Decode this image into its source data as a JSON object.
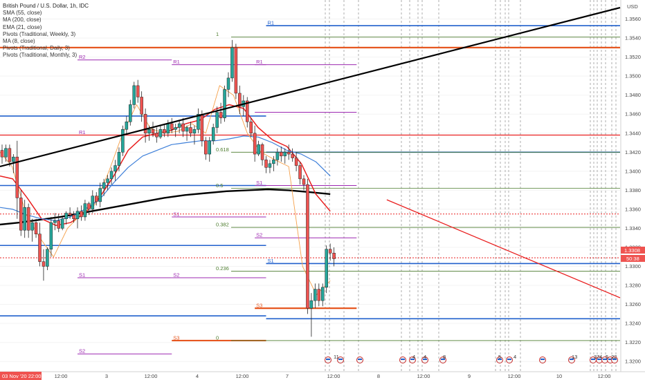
{
  "header": {
    "title": "British Pound / U.S. Dollar, 1h, IDC",
    "indicators": [
      "SMA (55, close)",
      "MA (200, close)",
      "EMA (21, close)",
      "Pivots (Traditional, Weekly, 3)",
      "MA (8, close)",
      "Pivots (Traditional, Daily, 3)",
      "Pivots (Traditional, Monthly, 3)"
    ]
  },
  "price_axis": {
    "currency": "USD",
    "current_price": "1.3308",
    "countdown": "50:38",
    "ticks": [
      "1.3560",
      "1.3540",
      "1.3520",
      "1.3500",
      "1.3480",
      "1.3460",
      "1.3440",
      "1.3420",
      "1.3400",
      "1.3380",
      "1.3360",
      "1.3340",
      "1.3320",
      "1.3300",
      "1.3280",
      "1.3260",
      "1.3240",
      "1.3220",
      "1.3200"
    ]
  },
  "time_axis": {
    "start_badge": "03 Nov '20  22:00",
    "ticks": [
      "12:00",
      "3",
      "12:00",
      "4",
      "12:00",
      "7",
      "12:00",
      "8",
      "12:00",
      "9",
      "12:00",
      "10",
      "12:00"
    ]
  },
  "colors": {
    "bull": "#26a69a",
    "bear": "#ef5350",
    "ma200": "#000000",
    "ema21": "#e91e1e",
    "sma55": "#3d7fd9",
    "ma8": "#f5a04a",
    "weekly_pivot": "#1f5fcc",
    "daily_pivot": "#9c27b0",
    "monthly_pivot": "#e6561f",
    "fib": "#4a7a2b",
    "trendline": "#e91e1e",
    "price_badge": "#ef5350"
  },
  "chart_data": {
    "type": "candlestick",
    "symbol": "GBPUSD",
    "interval": "1h",
    "y_range": [
      1.319,
      1.358
    ],
    "candles": [
      [
        1.3422,
        1.3428,
        1.3408,
        1.3415
      ],
      [
        1.3415,
        1.3428,
        1.341,
        1.3424
      ],
      [
        1.3424,
        1.3428,
        1.3405,
        1.341
      ],
      [
        1.341,
        1.3418,
        1.3398,
        1.3415
      ],
      [
        1.3415,
        1.3432,
        1.335,
        1.3372
      ],
      [
        1.3372,
        1.338,
        1.3332,
        1.3338
      ],
      [
        1.3338,
        1.337,
        1.333,
        1.3362
      ],
      [
        1.3362,
        1.3366,
        1.333,
        1.3338
      ],
      [
        1.3338,
        1.335,
        1.3326,
        1.3346
      ],
      [
        1.3346,
        1.335,
        1.333,
        1.3334
      ],
      [
        1.3334,
        1.3346,
        1.33,
        1.3305
      ],
      [
        1.3305,
        1.3318,
        1.3285,
        1.33
      ],
      [
        1.33,
        1.332,
        1.3296,
        1.3318
      ],
      [
        1.3318,
        1.3352,
        1.331,
        1.3346
      ],
      [
        1.3346,
        1.3356,
        1.3338,
        1.3348
      ],
      [
        1.3348,
        1.3355,
        1.3336,
        1.334
      ],
      [
        1.334,
        1.3352,
        1.3338,
        1.335
      ],
      [
        1.335,
        1.3358,
        1.3344,
        1.3356
      ],
      [
        1.3356,
        1.3362,
        1.335,
        1.3354
      ],
      [
        1.3354,
        1.3358,
        1.3346,
        1.335
      ],
      [
        1.335,
        1.3362,
        1.334,
        1.3358
      ],
      [
        1.3358,
        1.3364,
        1.3348,
        1.3352
      ],
      [
        1.3352,
        1.337,
        1.3348,
        1.3366
      ],
      [
        1.3366,
        1.3368,
        1.3354,
        1.336
      ],
      [
        1.336,
        1.338,
        1.3356,
        1.3374
      ],
      [
        1.3374,
        1.3378,
        1.3364,
        1.3368
      ],
      [
        1.3368,
        1.3388,
        1.3362,
        1.3382
      ],
      [
        1.3382,
        1.3392,
        1.3374,
        1.3388
      ],
      [
        1.3388,
        1.3396,
        1.338,
        1.3392
      ],
      [
        1.3392,
        1.3404,
        1.3386,
        1.34
      ],
      [
        1.34,
        1.3412,
        1.339,
        1.3406
      ],
      [
        1.3406,
        1.3425,
        1.34,
        1.342
      ],
      [
        1.342,
        1.3448,
        1.3416,
        1.3444
      ],
      [
        1.3444,
        1.3458,
        1.3438,
        1.3452
      ],
      [
        1.3452,
        1.3475,
        1.3448,
        1.347
      ],
      [
        1.347,
        1.3494,
        1.3466,
        1.349
      ],
      [
        1.349,
        1.3496,
        1.3472,
        1.3478
      ],
      [
        1.3478,
        1.3484,
        1.3452,
        1.346
      ],
      [
        1.346,
        1.3466,
        1.343,
        1.344
      ],
      [
        1.344,
        1.3448,
        1.3432,
        1.3444
      ],
      [
        1.3444,
        1.3452,
        1.3436,
        1.344
      ],
      [
        1.344,
        1.3446,
        1.343,
        1.3436
      ],
      [
        1.3436,
        1.3448,
        1.3434,
        1.3444
      ],
      [
        1.3444,
        1.345,
        1.3436,
        1.344
      ],
      [
        1.344,
        1.3454,
        1.3436,
        1.345
      ],
      [
        1.345,
        1.3456,
        1.344,
        1.3444
      ],
      [
        1.3444,
        1.345,
        1.3436,
        1.3446
      ],
      [
        1.3446,
        1.3454,
        1.344,
        1.345
      ],
      [
        1.345,
        1.3456,
        1.3436,
        1.3442
      ],
      [
        1.3442,
        1.3448,
        1.3432,
        1.3446
      ],
      [
        1.3446,
        1.3452,
        1.3436,
        1.344
      ],
      [
        1.344,
        1.3448,
        1.3428,
        1.3444
      ],
      [
        1.3444,
        1.3466,
        1.344,
        1.346
      ],
      [
        1.346,
        1.3464,
        1.3426,
        1.3432
      ],
      [
        1.3432,
        1.3436,
        1.3412,
        1.3418
      ],
      [
        1.3418,
        1.3436,
        1.341,
        1.3432
      ],
      [
        1.3432,
        1.345,
        1.3428,
        1.3446
      ],
      [
        1.3446,
        1.3468,
        1.344,
        1.3462
      ],
      [
        1.3462,
        1.3472,
        1.345,
        1.3456
      ],
      [
        1.3456,
        1.349,
        1.3452,
        1.3486
      ],
      [
        1.3486,
        1.3504,
        1.3478,
        1.3498
      ],
      [
        1.3498,
        1.3538,
        1.3494,
        1.353
      ],
      [
        1.353,
        1.3534,
        1.3476,
        1.3482
      ],
      [
        1.3482,
        1.349,
        1.346,
        1.3468
      ],
      [
        1.3468,
        1.348,
        1.3458,
        1.3474
      ],
      [
        1.3474,
        1.3478,
        1.3446,
        1.3452
      ],
      [
        1.3452,
        1.3456,
        1.3436,
        1.344
      ],
      [
        1.344,
        1.3448,
        1.341,
        1.3418
      ],
      [
        1.3418,
        1.3432,
        1.3416,
        1.3428
      ],
      [
        1.3428,
        1.343,
        1.3406,
        1.3412
      ],
      [
        1.3412,
        1.3416,
        1.3398,
        1.3404
      ],
      [
        1.3404,
        1.3412,
        1.3398,
        1.3408
      ],
      [
        1.3408,
        1.3416,
        1.34,
        1.3412
      ],
      [
        1.3412,
        1.3424,
        1.3406,
        1.342
      ],
      [
        1.342,
        1.3426,
        1.341,
        1.3416
      ],
      [
        1.3416,
        1.3424,
        1.3408,
        1.342
      ],
      [
        1.342,
        1.3428,
        1.3412,
        1.3418
      ],
      [
        1.3418,
        1.3424,
        1.341,
        1.3414
      ],
      [
        1.3414,
        1.342,
        1.34,
        1.3406
      ],
      [
        1.3406,
        1.341,
        1.3386,
        1.3392
      ],
      [
        1.3392,
        1.3396,
        1.338,
        1.3386
      ],
      [
        1.3386,
        1.3392,
        1.325,
        1.3256
      ],
      [
        1.3256,
        1.3272,
        1.3226,
        1.3264
      ],
      [
        1.3264,
        1.3282,
        1.3256,
        1.3276
      ],
      [
        1.3276,
        1.3282,
        1.3258,
        1.3264
      ],
      [
        1.3264,
        1.3282,
        1.3258,
        1.3278
      ],
      [
        1.3278,
        1.3322,
        1.3272,
        1.3318
      ],
      [
        1.3318,
        1.3324,
        1.3306,
        1.3314
      ],
      [
        1.3314,
        1.332,
        1.33,
        1.3308
      ]
    ],
    "moving_averages": [
      {
        "name": "MA (200, close)",
        "from_x": -1,
        "to_x": 87,
        "values": [
          1.3344,
          1.3346,
          1.3349,
          1.3352,
          1.3356,
          1.336,
          1.3364,
          1.3368,
          1.3372,
          1.3375,
          1.3377,
          1.3379,
          1.338,
          1.3381,
          1.338,
          1.3378,
          1.3376
        ]
      },
      {
        "name": "EMA (21, close)",
        "from_x": -1,
        "to_x": 87,
        "values": [
          1.3395,
          1.3392,
          1.3372,
          1.335,
          1.3343,
          1.3346,
          1.3356,
          1.3372,
          1.3395,
          1.3422,
          1.3436,
          1.344,
          1.3443,
          1.345,
          1.3454,
          1.3465,
          1.347,
          1.3466,
          1.3446,
          1.3433,
          1.3426,
          1.3408,
          1.3376,
          1.3358
        ]
      },
      {
        "name": "SMA (55, close)",
        "from_x": -1,
        "to_x": 87,
        "values": [
          1.3362,
          1.336,
          1.3354,
          1.335,
          1.3348,
          1.3352,
          1.336,
          1.337,
          1.3388,
          1.3404,
          1.3416,
          1.3422,
          1.3428,
          1.343,
          1.3432,
          1.3432,
          1.3434,
          1.3437,
          1.3436,
          1.343,
          1.3422,
          1.3418,
          1.341,
          1.3395
        ]
      },
      {
        "name": "MA (8, close)",
        "from_x": -1,
        "to_x": 87,
        "values": [
          1.342,
          1.3405,
          1.3355,
          1.333,
          1.331,
          1.334,
          1.3355,
          1.3365,
          1.34,
          1.344,
          1.347,
          1.3445,
          1.344,
          1.3442,
          1.345,
          1.344,
          1.349,
          1.348,
          1.344,
          1.342,
          1.3412,
          1.3405,
          1.33,
          1.327,
          1.3285
        ]
      }
    ],
    "pivot_levels": [
      {
        "group": "weekly",
        "label": "R1",
        "price": 1.3553,
        "from_x": 70,
        "to_x": 200
      },
      {
        "group": "weekly",
        "label": "",
        "price": 1.3458,
        "from_x": -1,
        "to_x": 70
      },
      {
        "group": "weekly",
        "label": "",
        "price": 1.342,
        "from_x": 70,
        "to_x": 200
      },
      {
        "group": "weekly",
        "label": "",
        "price": 1.3385,
        "from_x": -1,
        "to_x": 70
      },
      {
        "group": "weekly",
        "label": "",
        "price": 1.3322,
        "from_x": -1,
        "to_x": 70
      },
      {
        "group": "weekly",
        "label": "S1",
        "price": 1.3303,
        "from_x": 70,
        "to_x": 200
      },
      {
        "group": "weekly",
        "label": "",
        "price": 1.3248,
        "from_x": -1,
        "to_x": 70
      },
      {
        "group": "weekly",
        "label": "",
        "price": 1.3245,
        "from_x": 70,
        "to_x": 200
      },
      {
        "group": "daily",
        "label": "R1",
        "price": 1.3512,
        "from_x": 45,
        "to_x": 70
      },
      {
        "group": "daily",
        "label": "R1",
        "price": 1.3512,
        "from_x": 67,
        "to_x": 94
      },
      {
        "group": "daily",
        "label": "R2",
        "price": 1.3517,
        "from_x": 20,
        "to_x": 45
      },
      {
        "group": "daily",
        "label": "",
        "price": 1.3462,
        "from_x": 67,
        "to_x": 94
      },
      {
        "group": "daily",
        "label": "S1",
        "price": 1.3385,
        "from_x": 67,
        "to_x": 94
      },
      {
        "group": "daily",
        "label": "S1",
        "price": 1.3352,
        "from_x": 45,
        "to_x": 70
      },
      {
        "group": "daily",
        "label": "S2",
        "price": 1.333,
        "from_x": 67,
        "to_x": 94
      },
      {
        "group": "daily",
        "label": "S1",
        "price": 1.3288,
        "from_x": 20,
        "to_x": 45
      },
      {
        "group": "daily",
        "label": "S2",
        "price": 1.3288,
        "from_x": 45,
        "to_x": 70
      },
      {
        "group": "daily",
        "label": "S2",
        "price": 1.3208,
        "from_x": 20,
        "to_x": 45
      },
      {
        "group": "daily",
        "label": "R1",
        "price": 1.3438,
        "from_x": 20,
        "to_x": 45
      },
      {
        "group": "monthly",
        "label": "",
        "price": 1.353,
        "from_x": -1,
        "to_x": 200
      },
      {
        "group": "monthly",
        "label": "S3",
        "price": 1.3256,
        "from_x": 67,
        "to_x": 94
      },
      {
        "group": "monthly",
        "label": "S3",
        "price": 1.3222,
        "from_x": 45,
        "to_x": 70
      }
    ],
    "red_levels": [
      {
        "price": 1.3438,
        "style": "solid",
        "from_x": -1,
        "to_x": 200
      },
      {
        "price": 1.3355,
        "style": "dotted",
        "from_x": -1,
        "to_x": 200
      },
      {
        "price": 1.3309,
        "style": "dotted",
        "from_x": -1,
        "to_x": 200
      }
    ],
    "fib_levels": [
      {
        "label": "1",
        "price": 1.3541
      },
      {
        "label": "0.618",
        "price": 1.342
      },
      {
        "label": "0.5",
        "price": 1.3382
      },
      {
        "label": "0.382",
        "price": 1.3341
      },
      {
        "label": "0.236",
        "price": 1.3295
      },
      {
        "label": "0",
        "price": 1.3222
      }
    ],
    "trendlines": [
      {
        "name": "black-trend",
        "color": "#000000",
        "x1": -1,
        "y1": 1.3405,
        "x2": 200,
        "y2": 1.3572
      },
      {
        "name": "red-trend",
        "color": "#e91e1e",
        "x1": 102,
        "y1": 1.337,
        "x2": 200,
        "y2": 1.3267
      }
    ],
    "event_markers": [
      "11",
      "4",
      "4",
      "8",
      "5",
      "4",
      "13",
      "37",
      "4",
      "5",
      "22"
    ]
  }
}
